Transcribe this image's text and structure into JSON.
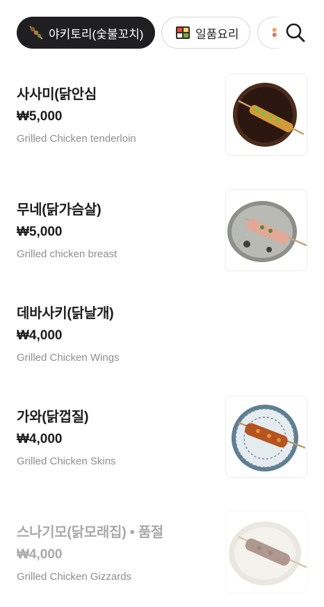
{
  "categories": [
    {
      "label": "야키토리(숯불꼬치)",
      "icon": "skewer-icon",
      "active": true
    },
    {
      "label": "일품요리",
      "icon": "bento-icon",
      "active": false
    },
    {
      "label": "",
      "icon": "drink-icon",
      "active": false
    }
  ],
  "search": {
    "icon": "search-icon"
  },
  "menu": [
    {
      "name": "사사미(닭안심",
      "price": "₩5,000",
      "desc": "Grilled Chicken tenderloin",
      "image": "dark-plate-skewer"
    },
    {
      "name": "무네(닭가슴살)",
      "price": "₩5,000",
      "desc": "Grilled chicken breast",
      "image": "grey-plate-skewer"
    },
    {
      "name": "데바사키(닭날개)",
      "price": "₩4,000",
      "desc": "Grilled Chicken Wings",
      "image": ""
    },
    {
      "name": "가와(닭껍질)",
      "price": "₩4,000",
      "desc": " Grilled Chicken Skins",
      "image": "blue-plate-skewer"
    },
    {
      "name": "스나기모(닭모래집) • 품절",
      "price": "₩4,000",
      "desc": "Grilled Chicken Gizzards",
      "image": "white-plate-skewer",
      "sold_out": true
    }
  ],
  "colors": {
    "chip_active_bg": "#1f1f21",
    "muted_text": "#8e8e93",
    "soldout_text": "#a9a9ad"
  }
}
